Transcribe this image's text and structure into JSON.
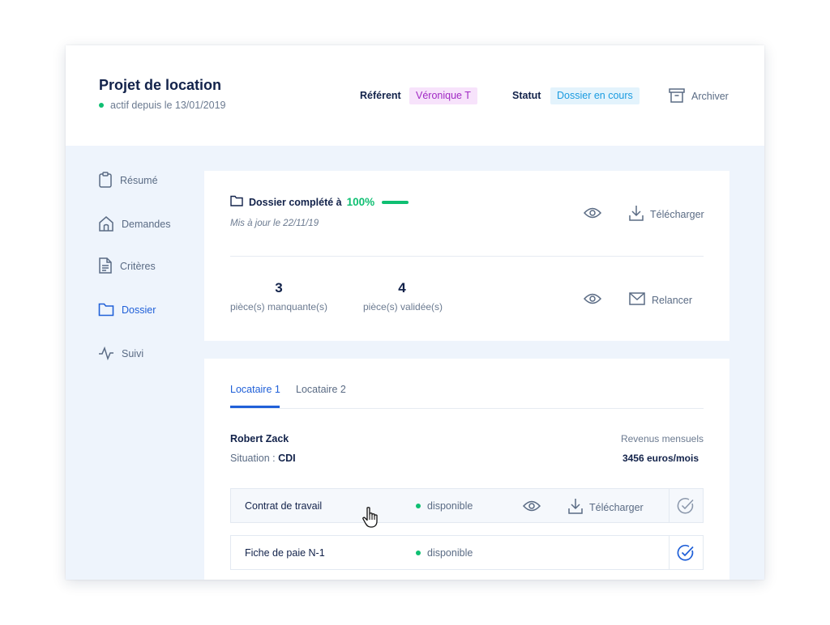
{
  "header": {
    "title": "Projet de location",
    "active_since": "actif depuis le 13/01/2019",
    "referent_label": "Référent",
    "referent_value": "Véronique T",
    "status_label": "Statut",
    "status_value": "Dossier en cours",
    "archive_label": "Archiver"
  },
  "sidebar": {
    "items": [
      {
        "label": "Résumé",
        "icon": "clipboard-icon",
        "active": false
      },
      {
        "label": "Demandes",
        "icon": "home-icon",
        "active": false
      },
      {
        "label": "Critères",
        "icon": "document-icon",
        "active": false
      },
      {
        "label": "Dossier",
        "icon": "folder-icon",
        "active": true
      },
      {
        "label": "Suivi",
        "icon": "activity-icon",
        "active": false
      }
    ]
  },
  "dossier": {
    "title": "Dossier complété à",
    "percent_label": "100%",
    "percent_value": 100,
    "updated": "Mis à jour le 22/11/19",
    "download_label": "Télécharger",
    "missing_count": "3",
    "missing_label": "pièce(s) manquante(s)",
    "validated_count": "4",
    "validated_label": "pièce(s) validée(s)",
    "remind_label": "Relancer"
  },
  "tenants": {
    "tabs": [
      {
        "label": "Locataire 1",
        "active": true
      },
      {
        "label": "Locataire 2",
        "active": false
      }
    ],
    "name": "Robert Zack",
    "situation_label": "Situation : ",
    "situation_value": "CDI",
    "revenue_label": "Revenus mensuels",
    "revenue_value": "3456 euros/mois",
    "documents": [
      {
        "name": "Contrat de travail",
        "status": "disponible",
        "download_label": "Télécharger",
        "validated": false
      },
      {
        "name": "Fiche de paie N-1",
        "status": "disponible",
        "validated": true
      }
    ]
  },
  "colors": {
    "accent": "#2060d8",
    "success": "#0fbf72",
    "navy": "#12224a",
    "referent_bg": "#f7e3fb",
    "referent_text": "#a12ac4",
    "status_bg": "#e3f3fc",
    "status_text": "#1a9be0"
  }
}
